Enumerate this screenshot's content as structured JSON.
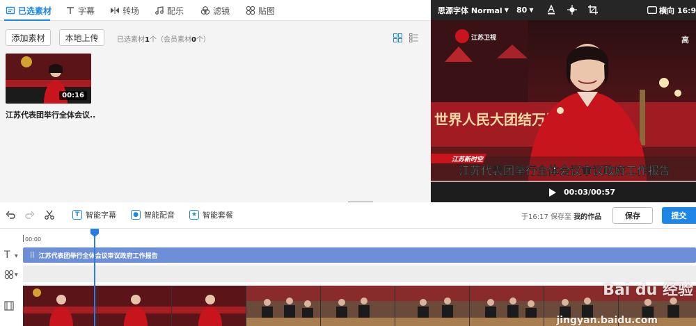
{
  "tabs": [
    {
      "label": "已选素材",
      "icon": "folder-icon",
      "active": true
    },
    {
      "label": "字幕",
      "icon": "text-icon"
    },
    {
      "label": "转场",
      "icon": "transition-icon"
    },
    {
      "label": "配乐",
      "icon": "music-icon"
    },
    {
      "label": "滤镜",
      "icon": "filter-icon"
    },
    {
      "label": "贴图",
      "icon": "sticker-icon"
    }
  ],
  "library": {
    "add_button": "添加素材",
    "upload_button": "本地上传",
    "count_prefix": "已选素材",
    "count": "1",
    "count_unit": "个",
    "member_prefix": "（会员素材",
    "member_count": "0",
    "member_suffix": "个）",
    "clip_duration": "00:16",
    "clip_title": "江苏代表团举行全体会议..."
  },
  "preview": {
    "font": "思源字体 Normal",
    "size": "80",
    "orientation": "横向 16:9",
    "channel_logo": "江苏卫视",
    "lower_third_tag": "江苏新时空",
    "caption": "江苏代表团举行全体会议审议政府工作报告",
    "time": "00:03/00:57",
    "background_banner": "世界人民大团结万岁",
    "corner_text": "高"
  },
  "toolbar": {
    "smart_subtitle": "智能字幕",
    "smart_dub": "智能配音",
    "smart_package": "智能套餐",
    "save_status_prefix": "于16:17 保存至",
    "save_location": "我的作品",
    "save_label": "保存",
    "submit_label": "提交"
  },
  "timeline": {
    "ruler_start": "00:00",
    "subtitle_text": "江苏代表团举行全体会议审议政府工作报告"
  },
  "watermark": {
    "brand": "Bai du 经验",
    "url": "jingyan.baidu.com"
  },
  "colors": {
    "accent": "#1e86e6",
    "subtitle_track": "#6c8fd8",
    "news_red": "#c8141c"
  }
}
